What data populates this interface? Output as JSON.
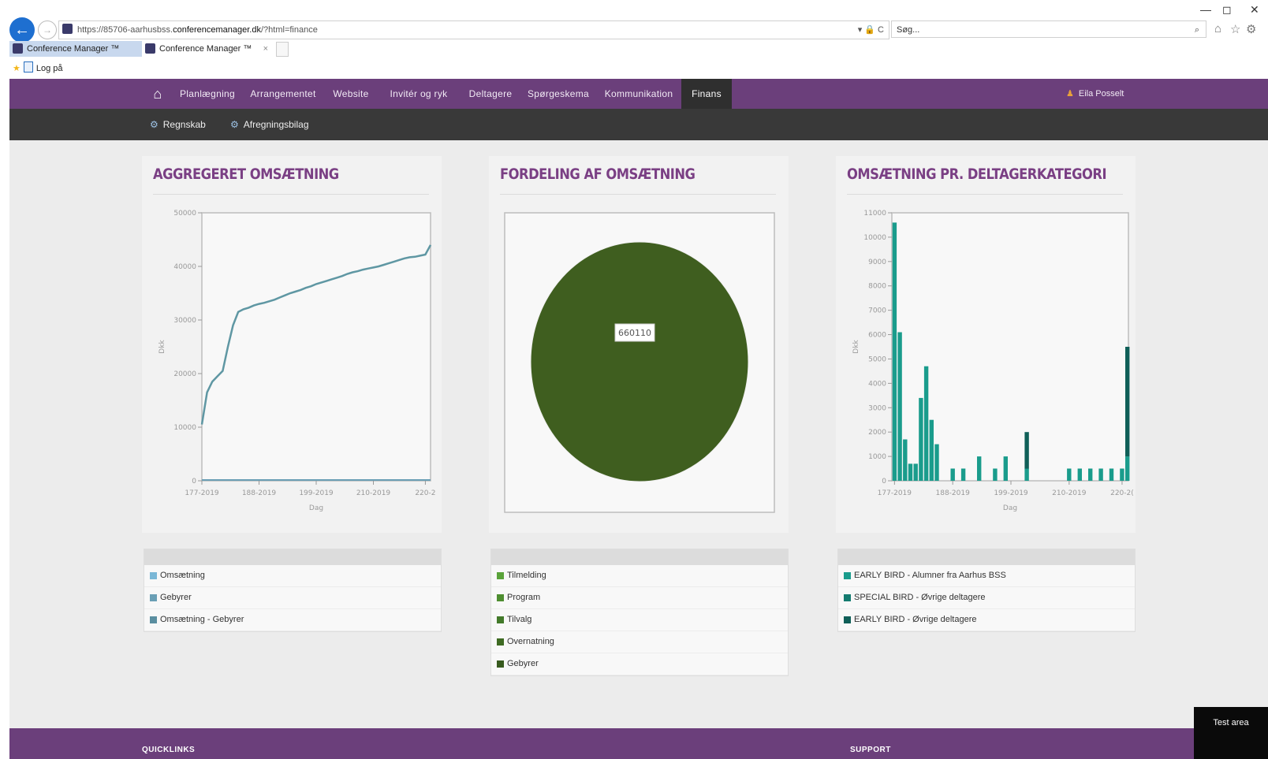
{
  "browser": {
    "url_prefix": "https://85706-aarhusbss.",
    "url_host": "conferencemanager.dk",
    "url_path": "/?html=finance",
    "addr_icons": "▾ 🔒 C",
    "search_placeholder": "Søg...",
    "tabs": [
      {
        "label": "Conference Manager ™",
        "active": true
      },
      {
        "label": "Conference Manager ™",
        "active": false
      }
    ],
    "tab_close": "×",
    "favorites": [
      {
        "label": "Log på"
      }
    ],
    "window_controls": {
      "minimize": "—",
      "restore": "◻",
      "close": "✕"
    }
  },
  "nav": {
    "items": [
      {
        "label": "Planlægning"
      },
      {
        "label": "Arrangementet"
      },
      {
        "label": "Website"
      },
      {
        "label": "Invitér og ryk"
      },
      {
        "label": "Deltagere"
      },
      {
        "label": "Spørgeskema"
      },
      {
        "label": "Kommunikation"
      },
      {
        "label": "Finans"
      }
    ],
    "active": "Finans",
    "user": "Eila Posselt"
  },
  "subnav": {
    "items": [
      {
        "label": "Regnskab"
      },
      {
        "label": "Afregningsbilag"
      }
    ]
  },
  "panels": {
    "aggregated": {
      "title": "AGGREGERET OMSÆTNING"
    },
    "distribution": {
      "title": "FORDELING AF OMSÆTNING"
    },
    "category": {
      "title": "OMSÆTNING PR. DELTAGERKATEGORI"
    }
  },
  "legends": {
    "aggregated": [
      {
        "label": "Omsætning",
        "color": "#7ab7d6"
      },
      {
        "label": "Gebyrer",
        "color": "#6a9fb5"
      },
      {
        "label": "Omsætning - Gebyrer",
        "color": "#5a8ea0"
      }
    ],
    "distribution": [
      {
        "label": "Tilmelding",
        "color": "#5aa33a"
      },
      {
        "label": "Program",
        "color": "#4e8e30"
      },
      {
        "label": "Tilvalg",
        "color": "#437a2a"
      },
      {
        "label": "Overnatning",
        "color": "#3e6a22"
      },
      {
        "label": "Gebyrer",
        "color": "#375a1e"
      }
    ],
    "category": [
      {
        "label": "EARLY BIRD - Alumner fra Aarhus BSS",
        "color": "#1a9c8c"
      },
      {
        "label": "SPECIAL BIRD - Øvrige deltagere",
        "color": "#147b70"
      },
      {
        "label": "EARLY BIRD - Øvrige deltagere",
        "color": "#0f5f58"
      }
    ]
  },
  "chart_data": [
    {
      "type": "line",
      "ylabel": "Dkk",
      "xlabel": "Dag",
      "ylim": [
        0,
        50000
      ],
      "xlim": [
        177,
        221
      ],
      "y_ticks": [
        "0",
        "10000",
        "20000",
        "30000",
        "40000",
        "50000"
      ],
      "x_ticks": [
        {
          "v": 177,
          "label": "177-2019"
        },
        {
          "v": 188,
          "label": "188-2019"
        },
        {
          "v": 199,
          "label": "199-2019"
        },
        {
          "v": 210,
          "label": "210-2019"
        },
        {
          "v": 220,
          "label": "220-2"
        }
      ],
      "series": [
        {
          "color": "#5f97a3",
          "points": [
            [
              177,
              10500
            ],
            [
              178,
              16500
            ],
            [
              179,
              18500
            ],
            [
              180,
              19500
            ],
            [
              181,
              20500
            ],
            [
              182,
              25000
            ],
            [
              183,
              29000
            ],
            [
              184,
              31500
            ],
            [
              185,
              32000
            ],
            [
              186,
              32300
            ],
            [
              187,
              32700
            ],
            [
              188,
              33000
            ],
            [
              189,
              33200
            ],
            [
              190,
              33500
            ],
            [
              191,
              33800
            ],
            [
              192,
              34200
            ],
            [
              193,
              34600
            ],
            [
              194,
              35000
            ],
            [
              195,
              35300
            ],
            [
              196,
              35600
            ],
            [
              197,
              36000
            ],
            [
              198,
              36300
            ],
            [
              199,
              36700
            ],
            [
              200,
              37000
            ],
            [
              201,
              37300
            ],
            [
              202,
              37600
            ],
            [
              203,
              37900
            ],
            [
              204,
              38200
            ],
            [
              205,
              38600
            ],
            [
              206,
              38900
            ],
            [
              207,
              39100
            ],
            [
              208,
              39400
            ],
            [
              209,
              39600
            ],
            [
              210,
              39800
            ],
            [
              211,
              40000
            ],
            [
              212,
              40300
            ],
            [
              213,
              40600
            ],
            [
              214,
              40900
            ],
            [
              215,
              41200
            ],
            [
              216,
              41500
            ],
            [
              217,
              41700
            ],
            [
              218,
              41800
            ],
            [
              219,
              42000
            ],
            [
              220,
              42200
            ],
            [
              221,
              44000
            ]
          ]
        }
      ]
    },
    {
      "type": "pie",
      "slices": [
        {
          "label": "660110",
          "value": 660110,
          "color": "#3f5e1f"
        }
      ]
    },
    {
      "type": "bar",
      "ylabel": "Dkk",
      "xlabel": "Dag",
      "ylim": [
        0,
        11000
      ],
      "xlim": [
        176.5,
        221.2
      ],
      "y_ticks": [
        "0",
        "1000",
        "2000",
        "3000",
        "4000",
        "5000",
        "6000",
        "7000",
        "8000",
        "9000",
        "10000",
        "11000"
      ],
      "x_ticks": [
        {
          "v": 177,
          "label": "177-2019"
        },
        {
          "v": 188,
          "label": "188-2019"
        },
        {
          "v": 199,
          "label": "199-2019"
        },
        {
          "v": 210,
          "label": "210-2019"
        },
        {
          "v": 220,
          "label": "220-2("
        }
      ],
      "categories": [
        177,
        178,
        179,
        180,
        181,
        182,
        183,
        184,
        185,
        186,
        188,
        190,
        193,
        196,
        198,
        202,
        206,
        210,
        212,
        214,
        216,
        218,
        220,
        221
      ],
      "series": [
        {
          "name": "EARLY BIRD - Alumner fra Aarhus BSS",
          "color": "#1a9c8c",
          "values": [
            10600,
            6100,
            1700,
            700,
            700,
            3400,
            4700,
            2500,
            1500,
            0,
            500,
            500,
            1000,
            500,
            1000,
            500,
            0,
            500,
            500,
            500,
            500,
            500,
            500,
            1000
          ]
        },
        {
          "name": "SPECIAL BIRD - Øvrige deltagere",
          "color": "#147b70",
          "values": [
            0,
            0,
            0,
            0,
            0,
            0,
            0,
            0,
            0,
            0,
            0,
            0,
            0,
            0,
            0,
            0,
            0,
            0,
            0,
            0,
            0,
            0,
            0,
            0
          ]
        },
        {
          "name": "EARLY BIRD - Øvrige deltagere",
          "color": "#0f5f58",
          "values": [
            0,
            0,
            0,
            0,
            0,
            0,
            0,
            0,
            0,
            0,
            0,
            0,
            0,
            0,
            0,
            1500,
            0,
            0,
            0,
            0,
            0,
            0,
            0,
            4500
          ]
        }
      ]
    }
  ],
  "footer": {
    "quicklinks": "QUICKLINKS",
    "support": "SUPPORT",
    "test_area": "Test area"
  }
}
